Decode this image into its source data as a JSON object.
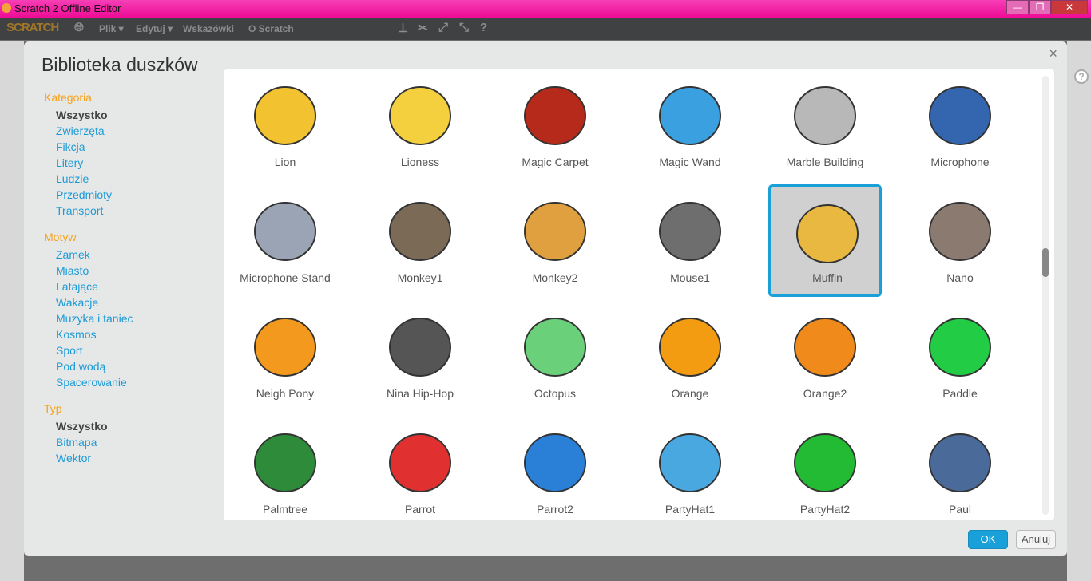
{
  "window": {
    "title": "Scratch 2 Offline Editor",
    "controls": [
      "—",
      "❐",
      "✕"
    ]
  },
  "menubar": {
    "logo": "SCRATCH",
    "items": [
      "Plik ▾",
      "Edytuj ▾",
      "Wskazówki",
      "O Scratch"
    ],
    "tool_icons": [
      "stamp-icon",
      "cut-icon",
      "grow-icon",
      "shrink-icon",
      "help-icon"
    ]
  },
  "dialog": {
    "title": "Biblioteka duszków",
    "close": "×",
    "ok": "OK",
    "cancel": "Anuluj"
  },
  "sidebar": {
    "groups": [
      {
        "heading": "Kategoria",
        "items": [
          "Wszystko",
          "Zwierzęta",
          "Fikcja",
          "Litery",
          "Ludzie",
          "Przedmioty",
          "Transport"
        ],
        "selected": 0
      },
      {
        "heading": "Motyw",
        "items": [
          "Zamek",
          "Miasto",
          "Latające",
          "Wakacje",
          "Muzyka i taniec",
          "Kosmos",
          "Sport",
          "Pod wodą",
          "Spacerowanie"
        ],
        "selected": -1
      },
      {
        "heading": "Typ",
        "items": [
          "Wszystko",
          "Bitmapa",
          "Wektor"
        ],
        "selected": 0
      }
    ]
  },
  "sprites": [
    {
      "name": "Lion",
      "color": "#f2c230"
    },
    {
      "name": "Lioness",
      "color": "#f4d03f"
    },
    {
      "name": "Magic Carpet",
      "color": "#b52a1a"
    },
    {
      "name": "Magic Wand",
      "color": "#3aa0e0"
    },
    {
      "name": "Marble Building",
      "color": "#b8b8b8"
    },
    {
      "name": "Microphone",
      "color": "#3466b0"
    },
    {
      "name": "Microphone Stand",
      "color": "#9aa4b4"
    },
    {
      "name": "Monkey1",
      "color": "#7b6a55"
    },
    {
      "name": "Monkey2",
      "color": "#e0a040"
    },
    {
      "name": "Mouse1",
      "color": "#6e6e6e"
    },
    {
      "name": "Muffin",
      "color": "#e8b840"
    },
    {
      "name": "Nano",
      "color": "#8a7a70"
    },
    {
      "name": "Neigh Pony",
      "color": "#f39a1e"
    },
    {
      "name": "Nina Hip-Hop",
      "color": "#555555"
    },
    {
      "name": "Octopus",
      "color": "#6ad07a"
    },
    {
      "name": "Orange",
      "color": "#f39c12"
    },
    {
      "name": "Orange2",
      "color": "#f08a1a"
    },
    {
      "name": "Paddle",
      "color": "#22cc44"
    },
    {
      "name": "Palmtree",
      "color": "#2e8b3a"
    },
    {
      "name": "Parrot",
      "color": "#e03030"
    },
    {
      "name": "Parrot2",
      "color": "#2a7fd6"
    },
    {
      "name": "PartyHat1",
      "color": "#4aa8e0"
    },
    {
      "name": "PartyHat2",
      "color": "#22bb33"
    },
    {
      "name": "Paul",
      "color": "#4a6a9a"
    }
  ],
  "selected_sprite": "Muffin",
  "scroll": {
    "position_fraction": 0.42
  }
}
